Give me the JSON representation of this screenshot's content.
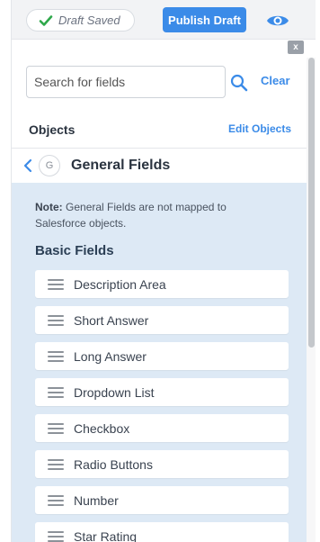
{
  "topbar": {
    "draft_status": "Draft Saved",
    "publish_label": "Publish Draft",
    "accent": "#3b8be8",
    "check_color": "#2ea84a"
  },
  "close_label": "x",
  "search": {
    "placeholder": "Search for fields",
    "value": "",
    "clear_label": "Clear"
  },
  "objects": {
    "title": "Objects",
    "edit_label": "Edit Objects"
  },
  "section": {
    "badge": "G",
    "title": "General Fields",
    "note_label": "Note:",
    "note_text": " General Fields are not mapped to Salesforce objects.",
    "group_title": "Basic Fields",
    "fields": [
      {
        "label": "Description Area"
      },
      {
        "label": "Short Answer"
      },
      {
        "label": "Long Answer"
      },
      {
        "label": "Dropdown List"
      },
      {
        "label": "Checkbox"
      },
      {
        "label": "Radio Buttons"
      },
      {
        "label": "Number"
      },
      {
        "label": "Star Rating"
      }
    ]
  },
  "icons": {
    "status": "check-icon",
    "preview": "eye-icon",
    "search": "search-icon",
    "back": "chevron-left-icon",
    "drag": "drag-handle-icon"
  }
}
